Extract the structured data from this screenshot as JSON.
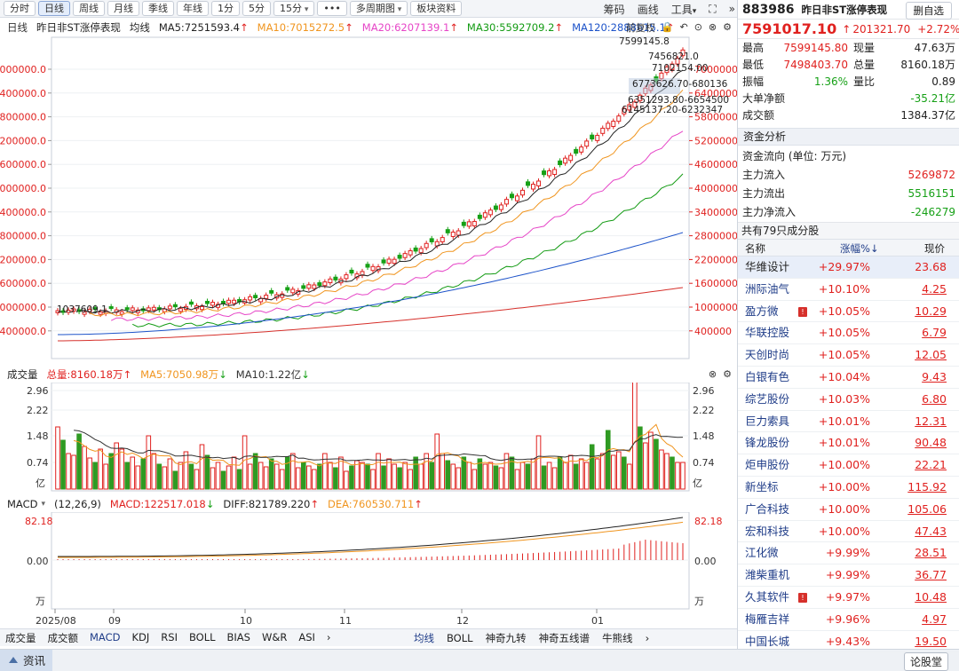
{
  "toolbar": {
    "periods": [
      {
        "label": "分时",
        "active": false
      },
      {
        "label": "日线",
        "active": true
      },
      {
        "label": "周线",
        "active": false
      },
      {
        "label": "月线",
        "active": false
      },
      {
        "label": "季线",
        "active": false
      },
      {
        "label": "年线",
        "active": false
      },
      {
        "label": "1分",
        "active": false
      },
      {
        "label": "5分",
        "active": false
      },
      {
        "label": "15分",
        "active": false,
        "dropdown": true
      },
      {
        "label": "•••",
        "active": false
      },
      {
        "label": "多周期图",
        "active": false,
        "dropdown": true
      },
      {
        "label": "板块资料",
        "active": false
      }
    ],
    "right": [
      "筹码",
      "画线",
      "工具"
    ],
    "tool_arrow": "▾",
    "expand_icon": "⛶",
    "collapse_icon": "»"
  },
  "main_chart": {
    "period": "日线",
    "name": "昨日非ST涨停表现",
    "mode": "均线",
    "ma": [
      {
        "label": "MA5:7251593.4",
        "color": "#222222",
        "arrow": "↑"
      },
      {
        "label": "MA10:7015272.5",
        "color": "#f0951f",
        "arrow": "↑"
      },
      {
        "label": "MA20:6207139.1",
        "color": "#e645c7",
        "arrow": "↑"
      },
      {
        "label": "MA30:5592709.2",
        "color": "#139b13",
        "arrow": "↑"
      },
      {
        "label": "MA120:2888615.1",
        "color": "#1d53c9",
        "arrow": "↑"
      }
    ],
    "fq": "前复权",
    "icons": [
      "🔒",
      "↶",
      "⊙",
      "⊗",
      "⚙"
    ],
    "left_ticks": [
      "7000000.0",
      "6400000.0",
      "5800000.0",
      "5200000.0",
      "4600000.0",
      "4000000.0",
      "3400000.0",
      "2800000.0",
      "2200000.0",
      "1600000.0",
      "1000000.0",
      "400000.0"
    ],
    "right_ticks": [
      "7000000",
      "6400000",
      "5800000",
      "5200000",
      "4600000",
      "4000000",
      "3400000",
      "2800000",
      "2200000",
      "1600000",
      "1000000",
      "400000"
    ],
    "annotations": {
      "high": "7599145.8",
      "low": "1037609.1",
      "v1": "7456821.0",
      "v2": "7102154.00",
      "v3": "6773626.70-680136",
      "v4": "6351293.80-6654500",
      "v5": "6145137.20-6232347"
    }
  },
  "volume_panel": {
    "title": "成交量",
    "total": "总量:8160.18万",
    "total_arrow": "↑",
    "ma5": "MA5:7050.98万",
    "ma5_arrow": "↓",
    "ma10": "MA10:1.22亿",
    "ma10_arrow": "↓",
    "ticks": [
      "2.96",
      "2.22",
      "1.48",
      "0.74"
    ],
    "unit": "亿"
  },
  "macd_panel": {
    "title": "MACD",
    "dropdown": "▾",
    "params": "(12,26,9)",
    "macd": "MACD:122517.018",
    "macd_arrow": "↓",
    "diff": "DIFF:821789.220",
    "diff_arrow": "↑",
    "dea": "DEA:760530.711",
    "dea_arrow": "↑",
    "ticks": [
      "82.18",
      "0.00"
    ],
    "unit": "万"
  },
  "date_axis": [
    "2025/08",
    "09",
    "10",
    "11",
    "12",
    "01"
  ],
  "bottom_tabs": [
    "成交量",
    "成交额",
    "MACD",
    "KDJ",
    "RSI",
    "BOLL",
    "BIAS",
    "W&R",
    "ASI",
    "›"
  ],
  "bottom_tabs_right": [
    "均线",
    "BOLL",
    "神奇九转",
    "神奇五线谱",
    "牛熊线",
    "›"
  ],
  "status": {
    "tab": "资讯",
    "button": "论股堂"
  },
  "quote": {
    "code": "883986",
    "name": "昨日非ST涨停表现",
    "btn": "删自选",
    "price": "7591017.10",
    "arrow": "↑",
    "change": "201321.70",
    "pct": "+2.72%",
    "rows": [
      {
        "l1": "最高",
        "v1": "7599145.80",
        "l2": "现量",
        "v2": "47.63万"
      },
      {
        "l1": "最低",
        "v1": "7498403.70",
        "l2": "总量",
        "v2": "8160.18万"
      },
      {
        "l1": "振幅",
        "v1": "1.36%",
        "l2": "量比",
        "v2": "0.89"
      }
    ],
    "big_label": "大单净额",
    "big_val": "-35.21亿",
    "amount_label": "成交额",
    "amount_val": "1384.37亿"
  },
  "capital": {
    "title": "资金分析",
    "unit_label": "资金流向 (单位: 万元)",
    "in_label": "主力流入",
    "in_val": "5269872",
    "out_label": "主力流出",
    "out_val": "5516151",
    "net_label": "主力净流入",
    "net_val": "-246279"
  },
  "stocks": {
    "count": "共有79只成分股",
    "h_name": "名称",
    "h_pct": "涨幅%↓",
    "h_price": "现价",
    "list": [
      {
        "name": "华维设计",
        "pct": "+29.97%",
        "price": "23.68",
        "flag": false
      },
      {
        "name": "洲际油气",
        "pct": "+10.10%",
        "price": "4.25",
        "flag": false
      },
      {
        "name": "盈方微",
        "pct": "+10.05%",
        "price": "10.29",
        "flag": true
      },
      {
        "name": "华联控股",
        "pct": "+10.05%",
        "price": "6.79",
        "flag": false
      },
      {
        "name": "天创时尚",
        "pct": "+10.05%",
        "price": "12.05",
        "flag": false
      },
      {
        "name": "白银有色",
        "pct": "+10.04%",
        "price": "9.43",
        "flag": false
      },
      {
        "name": "综艺股份",
        "pct": "+10.03%",
        "price": "6.80",
        "flag": false
      },
      {
        "name": "巨力索具",
        "pct": "+10.01%",
        "price": "12.31",
        "flag": false
      },
      {
        "name": "锋龙股份",
        "pct": "+10.01%",
        "price": "90.48",
        "flag": false
      },
      {
        "name": "炬申股份",
        "pct": "+10.00%",
        "price": "22.21",
        "flag": false
      },
      {
        "name": "新坐标",
        "pct": "+10.00%",
        "price": "115.92",
        "flag": false
      },
      {
        "name": "广合科技",
        "pct": "+10.00%",
        "price": "105.06",
        "flag": false
      },
      {
        "name": "宏和科技",
        "pct": "+10.00%",
        "price": "47.43",
        "flag": false
      },
      {
        "name": "江化微",
        "pct": "+9.99%",
        "price": "28.51",
        "flag": false
      },
      {
        "name": "潍柴重机",
        "pct": "+9.99%",
        "price": "36.77",
        "flag": false
      },
      {
        "name": "久其软件",
        "pct": "+9.97%",
        "price": "10.48",
        "flag": true
      },
      {
        "name": "梅雁吉祥",
        "pct": "+9.96%",
        "price": "4.97",
        "flag": false
      },
      {
        "name": "中国长城",
        "pct": "+9.43%",
        "price": "19.50",
        "flag": false
      }
    ],
    "flag_text": "!"
  }
}
